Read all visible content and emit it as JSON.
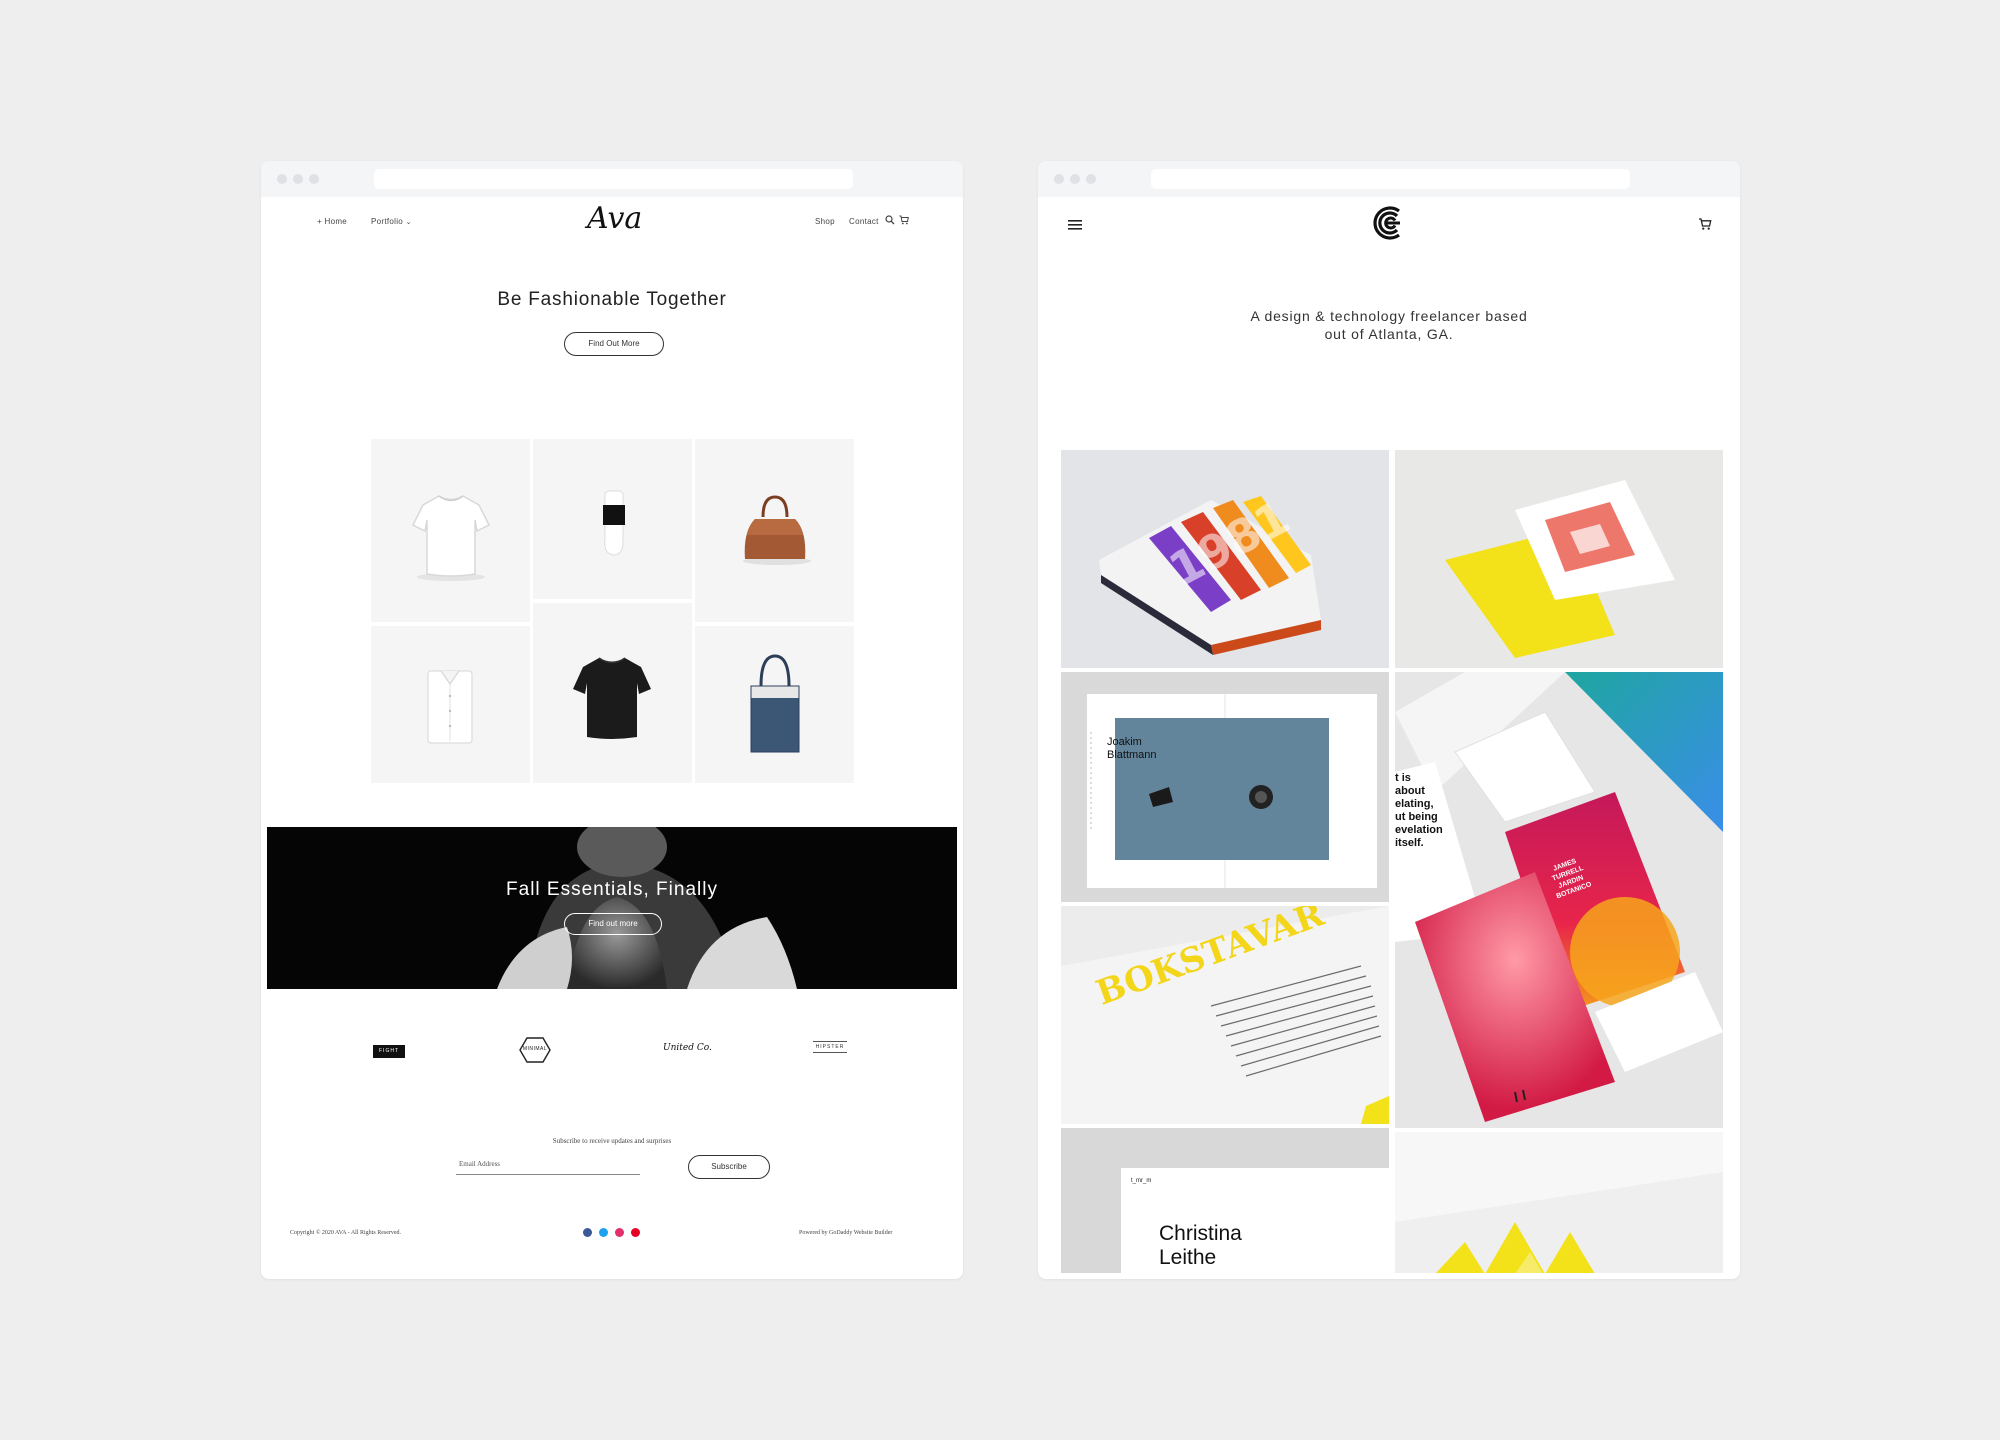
{
  "left_site": {
    "nav": {
      "home": "+ Home",
      "portfolio": "Portfolio",
      "shop": "Shop",
      "contact": "Contact"
    },
    "logo": "Ava",
    "hero": {
      "title": "Be Fashionable Together",
      "button": "Find Out More"
    },
    "products": [
      "t-shirt-white",
      "socks",
      "handbag-brown",
      "shirt-folded",
      "t-shirt-black",
      "tote-denim"
    ],
    "banner": {
      "title": "Fall Essentials, Finally",
      "button": "Find out more"
    },
    "brands": [
      "FIGHT",
      "MINIMAL",
      "United Co.",
      "HIPSTER"
    ],
    "subscribe": {
      "caption": "Subscribe to receive updates and surprises",
      "placeholder": "Email Address",
      "button": "Subscribe"
    },
    "footer": {
      "copyright": "Copyright © 2020 AVA - All Rights Reserved.",
      "powered": "Powered by GoDaddy Website Builder",
      "social": [
        "facebook-icon",
        "twitter-icon",
        "instagram-icon",
        "pinterest-icon"
      ]
    },
    "colors": {
      "facebook": "#3b5998",
      "twitter": "#1da1f2",
      "instagram": "#e1306c",
      "pinterest": "#e60023"
    }
  },
  "right_site": {
    "tagline_line1": "A design & technology freelancer based",
    "tagline_line2": "out of Atlanta, GA.",
    "gallery": {
      "book_digits": "1981",
      "joakim_name_1": "Joakim",
      "joakim_name_2": "Blattmann",
      "card_text": [
        "t is",
        "about",
        "elating,",
        "ut being",
        "evelation",
        "itself."
      ],
      "bokstavar": "BOKSTAVAR",
      "tmm_label": "t_mr_m",
      "christina_1": "Christina",
      "christina_2": "Leithe",
      "card_name_1": "JAMES",
      "card_name_2": "TURRELL",
      "card_name_3": "JARDIN",
      "card_name_4": "BOTANICO"
    }
  }
}
